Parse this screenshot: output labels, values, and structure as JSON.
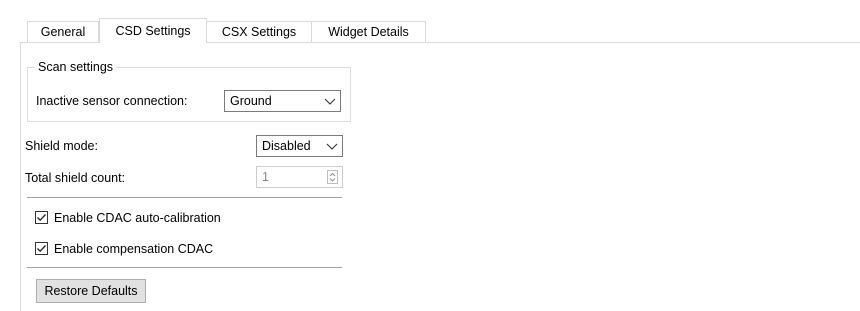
{
  "tabs": [
    {
      "label": "General",
      "active": false
    },
    {
      "label": "CSD Settings",
      "active": true
    },
    {
      "label": "CSX Settings",
      "active": false
    },
    {
      "label": "Widget Details",
      "active": false
    }
  ],
  "scan_settings": {
    "title": "Scan settings",
    "inactive_sensor_label": "Inactive sensor connection:",
    "inactive_sensor_value": "Ground"
  },
  "shield_mode": {
    "label": "Shield mode:",
    "value": "Disabled"
  },
  "total_shield_count": {
    "label": "Total shield count:",
    "value": "1",
    "enabled": false
  },
  "checkboxes": [
    {
      "label": "Enable CDAC auto-calibration",
      "checked": true
    },
    {
      "label": "Enable compensation CDAC",
      "checked": true
    }
  ],
  "restore_defaults_label": "Restore Defaults",
  "icons": {
    "dropdown": "chevron-down-icon",
    "spinner": "spinner-arrows-icon",
    "check": "check-icon"
  }
}
